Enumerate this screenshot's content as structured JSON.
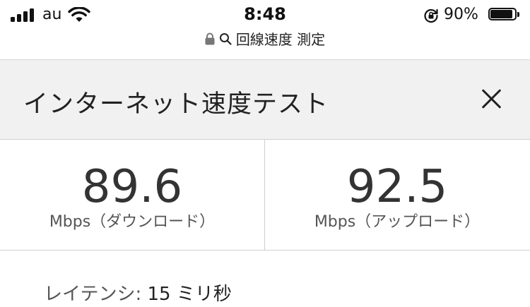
{
  "status_bar": {
    "carrier": "au",
    "time": "8:48",
    "battery_percent": "90%",
    "battery_level": 0.9
  },
  "url_bar": {
    "text": "回線速度 測定"
  },
  "header": {
    "title": "インターネット速度テスト"
  },
  "results": {
    "download": {
      "value": "89.6",
      "unit": "Mbps（ダウンロード）"
    },
    "upload": {
      "value": "92.5",
      "unit": "Mbps（アップロード）"
    }
  },
  "latency": {
    "label": "レイテンシ: ",
    "value": "15",
    "unit": " ミリ秒"
  }
}
